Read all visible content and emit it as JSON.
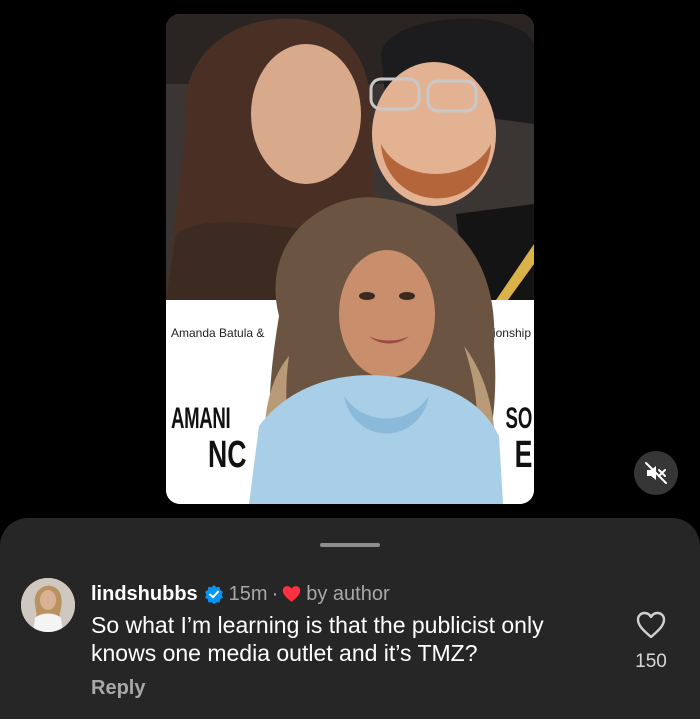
{
  "video": {
    "caption_left": "Amanda Batula &",
    "caption_right": "ionship",
    "headline_left_1": "AMANI",
    "headline_left_2": "NC",
    "headline_right_1": "SO",
    "headline_right_2": "E",
    "mute_icon": "speaker-muted-icon"
  },
  "comment": {
    "username": "lindshubbs",
    "verified_icon": "verified-badge-icon",
    "time": "15m",
    "separator": "·",
    "liked_by": "by author",
    "text": "So what I’m learning is that the publicist only knows one media outlet and it’s TMZ?",
    "reply_label": "Reply",
    "like_count": "150",
    "like_icon": "heart-outline-icon"
  },
  "colors": {
    "sheet_background": "#262626",
    "verified_blue": "#0095f6",
    "liked_red": "#ff3040",
    "secondary_text": "#a8a8a8"
  }
}
